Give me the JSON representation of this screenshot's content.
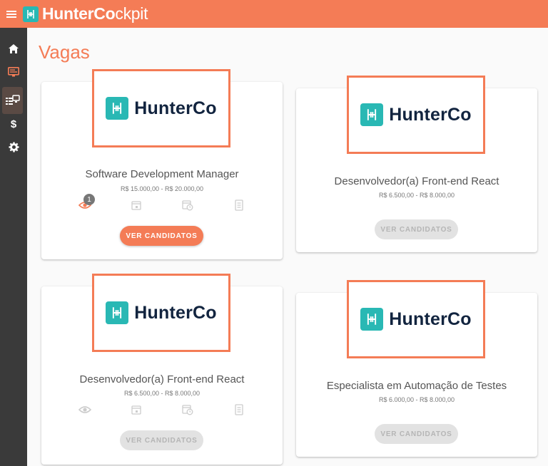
{
  "app": {
    "brand_bold": "HunterCo",
    "brand_light": "ckpit",
    "logo_text": "HunterCo"
  },
  "colors": {
    "accent": "#f47c56",
    "teal": "#29b8b4",
    "navy": "#12243f",
    "sidebar": "#3a3a3a"
  },
  "sidebar": {
    "items": [
      {
        "icon": "home-icon"
      },
      {
        "icon": "monitor-icon"
      },
      {
        "icon": "job-list-icon"
      },
      {
        "icon": "dollar-icon"
      },
      {
        "icon": "gear-icon"
      }
    ]
  },
  "page": {
    "title": "Vagas"
  },
  "jobs": [
    {
      "title": "Software Development Manager",
      "salary": "R$ 15.000,00 - R$ 20.000,00",
      "button": "VER CANDIDATOS",
      "views_badge": "1",
      "enabled": true
    },
    {
      "title": "Desenvolvedor(a) Front-end React",
      "salary": "R$ 6.500,00 - R$ 8.000,00",
      "button": "VER CANDIDATOS",
      "enabled": false
    },
    {
      "title": "Desenvolvedor(a) Front-end React",
      "salary": "R$ 6.500,00 - R$ 8.000,00",
      "button": "VER CANDIDATOS",
      "enabled": false
    },
    {
      "title": "Especialista em Automação de Testes",
      "salary": "R$ 6.000,00 - R$ 8.000,00",
      "button": "VER CANDIDATOS",
      "enabled": false
    }
  ]
}
